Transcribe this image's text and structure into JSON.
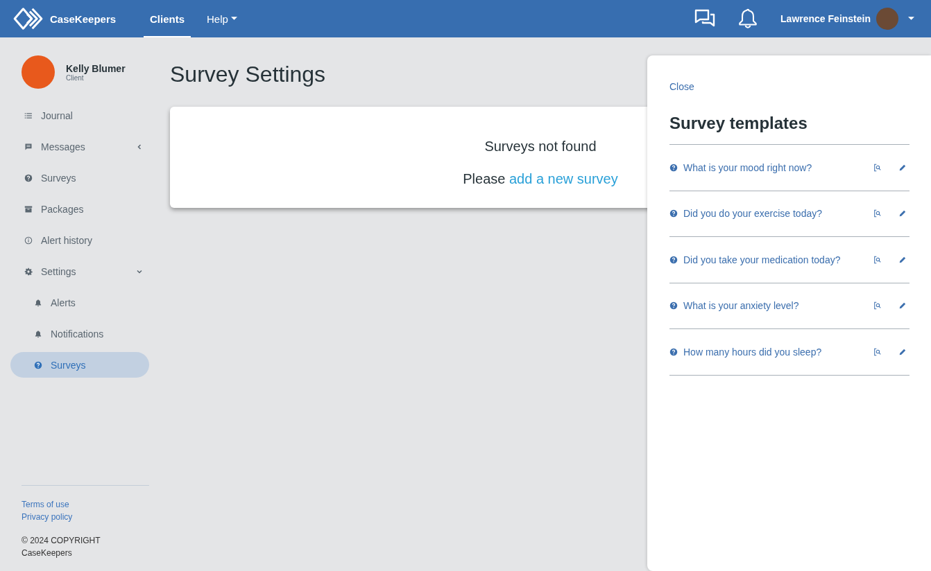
{
  "header": {
    "brand": "CaseKeepers",
    "nav": [
      {
        "label": "Clients",
        "selected": true,
        "dropdown": false
      },
      {
        "label": "Help",
        "selected": false,
        "dropdown": true
      }
    ],
    "user": "Lawrence Feinstein"
  },
  "profile": {
    "name": "Kelly Blumer",
    "role": "Client"
  },
  "sidebar": {
    "items": [
      {
        "label": "Journal",
        "kind": "link",
        "selected": false
      },
      {
        "label": "Messages",
        "kind": "group",
        "expanded": false,
        "selected": false
      },
      {
        "label": "Surveys",
        "kind": "link",
        "selected": false
      },
      {
        "label": "Packages",
        "kind": "link",
        "selected": false
      },
      {
        "label": "Alert history",
        "kind": "link",
        "selected": false
      },
      {
        "label": "Settings",
        "kind": "group",
        "expanded": true,
        "selected": false,
        "children": [
          {
            "label": "Alerts",
            "selected": false
          },
          {
            "label": "Notifications",
            "selected": false
          },
          {
            "label": "Surveys",
            "selected": true
          }
        ]
      }
    ],
    "links": [
      "Terms of use",
      "Privacy policy"
    ],
    "copyright": [
      "© 2024 COPYRIGHT",
      "CaseKeepers"
    ]
  },
  "page": {
    "title": "Survey Settings",
    "empty_title": "Surveys not found",
    "empty_text": "Please",
    "empty_link": "add a new survey"
  },
  "panel": {
    "close": "Close",
    "title": "Survey templates",
    "templates": [
      "What is your mood right now?",
      "Did you do your exercise today?",
      "Did you take your medication today?",
      "What is your anxiety level?",
      "How many hours did you sleep?"
    ]
  }
}
